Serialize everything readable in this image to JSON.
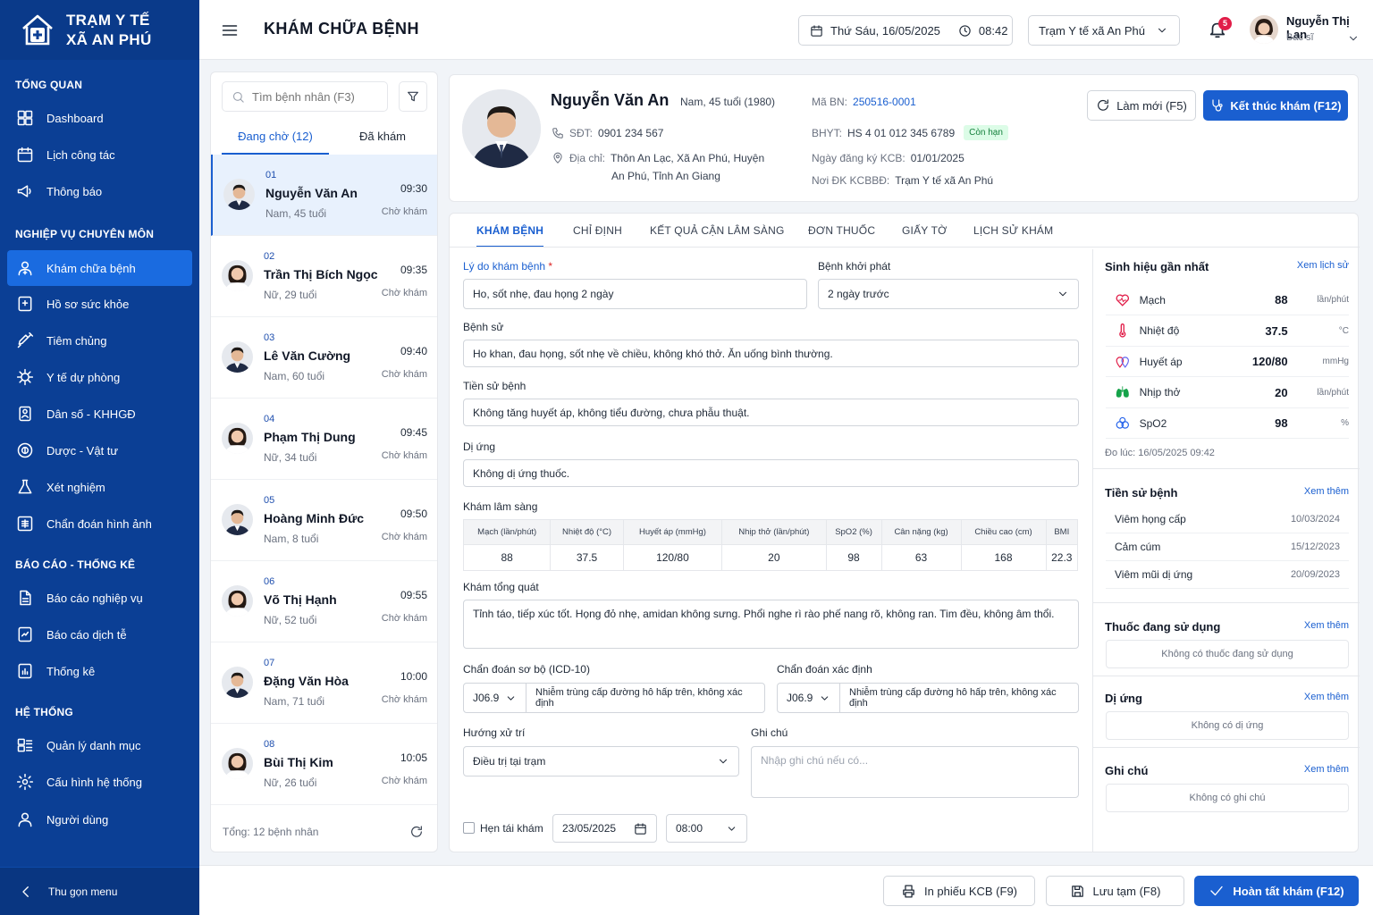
{
  "brand": {
    "line1": "TRẠM Y TẾ",
    "line2": "XÃ AN PHÚ"
  },
  "sidebar": {
    "sections": [
      "TỔNG QUAN",
      "NGHIỆP VỤ CHUYÊN MÔN",
      "BÁO CÁO - THỐNG KÊ",
      "HỆ THỐNG"
    ],
    "items": [
      "Dashboard",
      "Lịch công tác",
      "Thông báo",
      "Khám chữa bệnh",
      "Hồ sơ sức khỏe",
      "Tiêm chủng",
      "Y tế dự phòng",
      "Dân số - KHHGĐ",
      "Dược - Vật tư",
      "Xét nghiệm",
      "Chẩn đoán hình ảnh",
      "Báo cáo nghiệp vụ",
      "Báo cáo dịch tễ",
      "Thống kê",
      "Quản lý danh mục",
      "Cấu hình hệ thống",
      "Người dùng"
    ],
    "collapse": "Thu gọn menu"
  },
  "header": {
    "title": "KHÁM CHỮA BỆNH",
    "date": "Thứ Sáu, 16/05/2025",
    "time": "08:42",
    "facility": "Trạm Y tế xã An Phú",
    "notif_count": "5",
    "user_name": "Nguyễn Thị Lan",
    "user_role": "Bác sĩ"
  },
  "patients": {
    "search_placeholder": "Tìm bệnh nhân (F3)",
    "tab_waiting": "Đang chờ (12)",
    "tab_done": "Đã khám",
    "list": [
      {
        "no": "01",
        "name": "Nguyễn Văn An",
        "info": "Nam, 45 tuổi",
        "time": "09:30",
        "status": "Chờ khám"
      },
      {
        "no": "02",
        "name": "Trần Thị Bích Ngọc",
        "info": "Nữ, 29 tuổi",
        "time": "09:35",
        "status": "Chờ khám"
      },
      {
        "no": "03",
        "name": "Lê Văn Cường",
        "info": "Nam, 60 tuổi",
        "time": "09:40",
        "status": "Chờ khám"
      },
      {
        "no": "04",
        "name": "Phạm Thị Dung",
        "info": "Nữ, 34 tuổi",
        "time": "09:45",
        "status": "Chờ khám"
      },
      {
        "no": "05",
        "name": "Hoàng Minh Đức",
        "info": "Nam, 8 tuổi",
        "time": "09:50",
        "status": "Chờ khám"
      },
      {
        "no": "06",
        "name": "Võ Thị Hạnh",
        "info": "Nữ, 52 tuổi",
        "time": "09:55",
        "status": "Chờ khám"
      },
      {
        "no": "07",
        "name": "Đặng Văn Hòa",
        "info": "Nam, 71 tuổi",
        "time": "10:00",
        "status": "Chờ khám"
      },
      {
        "no": "08",
        "name": "Bùi Thị Kim",
        "info": "Nữ, 26 tuổi",
        "time": "10:05",
        "status": "Chờ khám"
      }
    ],
    "total": "Tổng: 12 bệnh nhân"
  },
  "patient": {
    "name": "Nguyễn Văn An",
    "demo": "Nam, 45 tuổi (1980)",
    "phone_label": "SĐT:",
    "phone": "0901 234 567",
    "addr_label": "Địa chỉ:",
    "addr1": "Thôn An Lạc, Xã An Phú, Huyện",
    "addr2": "An Phú, Tỉnh An Giang",
    "id_label": "Mã BN:",
    "id": "250516-0001",
    "bhyt_label": "BHYT:",
    "bhyt": "HS 4 01 012 345 6789",
    "bhyt_status": "Còn hạn",
    "reg_label": "Ngày đăng ký KCB:",
    "reg": "01/01/2025",
    "place_label": "Nơi ĐK KCBBĐ:",
    "place": "Trạm Y tế xã An Phú",
    "refresh": "Làm mới (F5)",
    "end": "Kết thúc khám (F12)"
  },
  "tabs": [
    "KHÁM BỆNH",
    "CHỈ ĐỊNH",
    "KẾT QUẢ CẬN LÂM SÀNG",
    "ĐƠN THUỐC",
    "GIẤY TỜ",
    "LỊCH SỬ KHÁM"
  ],
  "exam": {
    "reason_label": "Lý do khám bệnh",
    "reason": "Ho, sốt nhẹ, đau họng 2 ngày",
    "onset_label": "Bệnh khởi phát",
    "onset": "2 ngày trước",
    "history_label": "Bệnh sử",
    "history": "Ho khan, đau họng, sốt nhẹ về chiều, không khó thở. Ăn uống bình thường.",
    "past_label": "Tiền sử bệnh",
    "past": "Không tăng huyết áp, không tiểu đường, chưa phẫu thuật.",
    "allergy_label": "Dị ứng",
    "allergy": "Không dị ứng thuốc.",
    "clinical_label": "Khám lâm sàng",
    "vitals_headers": [
      "Mạch (lần/phút)",
      "Nhiệt độ (°C)",
      "Huyết áp (mmHg)",
      "Nhịp thở (lần/phút)",
      "SpO2 (%)",
      "Cân nặng (kg)",
      "Chiều cao (cm)",
      "BMI"
    ],
    "vitals_values": [
      "88",
      "37.5",
      "120/80",
      "20",
      "98",
      "63",
      "168",
      "22.3"
    ],
    "general_label": "Khám tổng quát",
    "general": "Tỉnh táo, tiếp xúc tốt. Họng đỏ nhẹ, amidan không sưng. Phổi nghe rì rào phế nang rõ, không ran. Tim đều, không âm thổi.",
    "prelim_label": "Chẩn đoán sơ bộ (ICD-10)",
    "prelim_code": "J06.9",
    "prelim_text": "Nhiễm trùng cấp đường hô hấp trên, không xác định",
    "final_label": "Chẩn đoán xác định",
    "final_code": "J06.9",
    "final_text": "Nhiễm trùng cấp đường hô hấp trên, không xác định",
    "treat_label": "Hướng xử trí",
    "treat": "Điều trị tại trạm",
    "note_label": "Ghi chú",
    "note_placeholder": "Nhập ghi chú nếu có...",
    "recheck_label": "Hẹn tái khám",
    "recheck_date": "23/05/2025",
    "recheck_time": "08:00"
  },
  "vitals_panel": {
    "title": "Sinh hiệu gần nhất",
    "link": "Xem lịch sử",
    "rows": [
      {
        "name": "Mạch",
        "value": "88",
        "unit": "lần/phút"
      },
      {
        "name": "Nhiệt độ",
        "value": "37.5",
        "unit": "°C"
      },
      {
        "name": "Huyết áp",
        "value": "120/80",
        "unit": "mmHg"
      },
      {
        "name": "Nhịp thở",
        "value": "20",
        "unit": "lần/phút"
      },
      {
        "name": "SpO2",
        "value": "98",
        "unit": "%"
      }
    ],
    "measured": "Đo lúc: 16/05/2025 09:42"
  },
  "history_panel": {
    "title": "Tiền sử bệnh",
    "link": "Xem thêm",
    "rows": [
      {
        "name": "Viêm họng cấp",
        "date": "10/03/2024"
      },
      {
        "name": "Cảm cúm",
        "date": "15/12/2023"
      },
      {
        "name": "Viêm mũi dị ứng",
        "date": "20/09/2023"
      }
    ]
  },
  "meds_panel": {
    "title": "Thuốc đang sử dụng",
    "link": "Xem thêm",
    "empty": "Không có thuốc đang sử dụng"
  },
  "allergy_panel": {
    "title": "Dị ứng",
    "link": "Xem thêm",
    "empty": "Không có dị ứng"
  },
  "note_panel": {
    "title": "Ghi chú",
    "link": "Xem thêm",
    "empty": "Không có ghi chú"
  },
  "footer": {
    "print": "In phiếu KCB  (F9)",
    "save": "Lưu tạm  (F8)",
    "complete": "Hoàn tất khám  (F12)"
  },
  "colors": {
    "sidebar": "#0b3f95",
    "active": "#1a6be0",
    "primary": "#1a5fd0"
  }
}
